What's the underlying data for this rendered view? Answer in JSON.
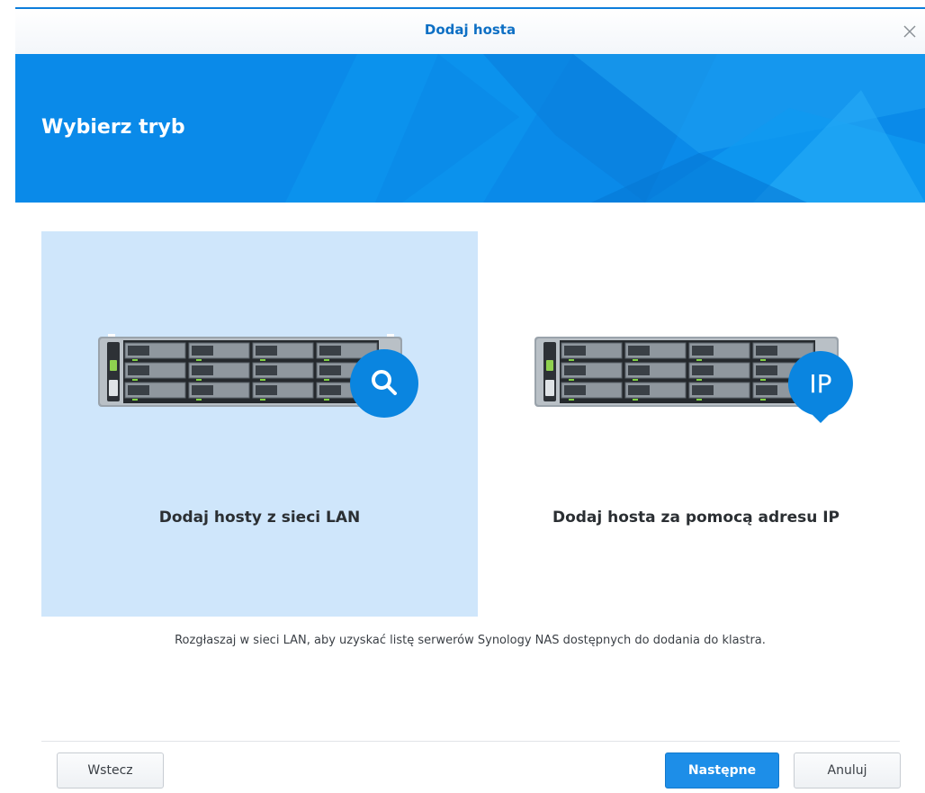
{
  "dialog": {
    "title": "Dodaj hosta",
    "close_icon": "close-icon"
  },
  "banner": {
    "heading": "Wybierz tryb"
  },
  "modes": [
    {
      "label": "Dodaj hosty z sieci LAN",
      "selected": true,
      "badge_icon": "search-icon"
    },
    {
      "label": "Dodaj hosta za pomocą adresu IP",
      "selected": false,
      "badge_icon": "ip-badge-icon",
      "badge_text": "IP"
    }
  ],
  "description": "Rozgłaszaj w sieci LAN, aby uzyskać listę serwerów Synology NAS dostępnych do dodania do klastra.",
  "buttons": {
    "back": "Wstecz",
    "next": "Następne",
    "cancel": "Anuluj"
  },
  "colors": {
    "accent": "#0d7ddb",
    "banner": "#0886e8",
    "selected_card": "#cfe6fb",
    "primary_button": "#1d8ee8"
  }
}
